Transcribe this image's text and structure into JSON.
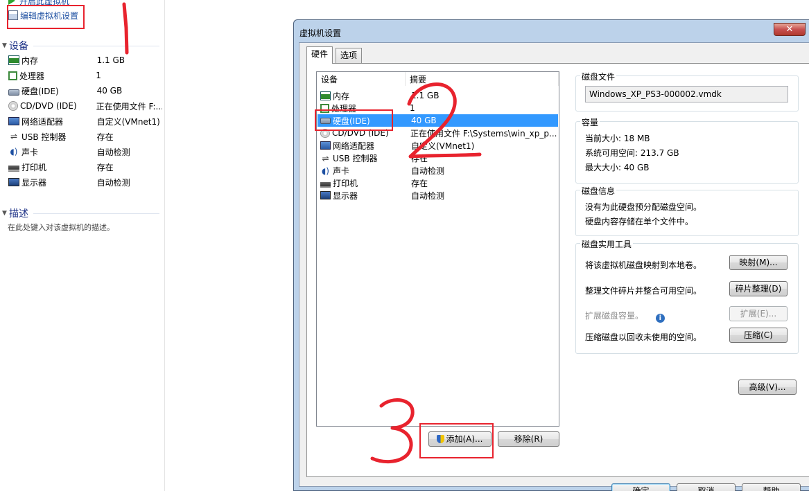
{
  "left_panel": {
    "power_on_label": "开启此虚拟机",
    "edit_settings_label": "编辑虚拟机设置",
    "devices_header": "设备",
    "devices": [
      {
        "name": "内存",
        "value": "1.1 GB",
        "icon": "memory-icon"
      },
      {
        "name": "处理器",
        "value": "1",
        "icon": "cpu-icon"
      },
      {
        "name": "硬盘(IDE)",
        "value": "40 GB",
        "icon": "hard-disk-icon"
      },
      {
        "name": "CD/DVD (IDE)",
        "value": "正在使用文件 F:...",
        "icon": "cd-dvd-icon"
      },
      {
        "name": "网络适配器",
        "value": "自定义(VMnet1)",
        "icon": "network-adapter-icon"
      },
      {
        "name": "USB 控制器",
        "value": "存在",
        "icon": "usb-icon"
      },
      {
        "name": "声卡",
        "value": "自动检测",
        "icon": "sound-card-icon"
      },
      {
        "name": "打印机",
        "value": "存在",
        "icon": "printer-icon"
      },
      {
        "name": "显示器",
        "value": "自动检测",
        "icon": "display-icon"
      }
    ],
    "description_header": "描述",
    "description_placeholder": "在此处键入对该虚拟机的描述。"
  },
  "dialog": {
    "title": "虚拟机设置",
    "close_glyph": "✕",
    "tabs": [
      {
        "label": "硬件"
      },
      {
        "label": "选项"
      }
    ],
    "device_list": {
      "col_device": "设备",
      "col_summary": "摘要",
      "rows": [
        {
          "name": "内存",
          "value": "1.1 GB"
        },
        {
          "name": "处理器",
          "value": "1"
        },
        {
          "name": "硬盘(IDE)",
          "value": "40 GB"
        },
        {
          "name": "CD/DVD (IDE)",
          "value": "正在使用文件 F:\\Systems\\win_xp_p..."
        },
        {
          "name": "网络适配器",
          "value": "自定义(VMnet1)"
        },
        {
          "name": "USB 控制器",
          "value": "存在"
        },
        {
          "name": "声卡",
          "value": "自动检测"
        },
        {
          "name": "打印机",
          "value": "存在"
        },
        {
          "name": "显示器",
          "value": "自动检测"
        }
      ],
      "selected_index": 2
    },
    "add_button": "添加(A)...",
    "remove_button": "移除(R)",
    "disk_file": {
      "title": "磁盘文件",
      "value": "Windows_XP_PS3-000002.vmdk"
    },
    "capacity": {
      "title": "容量",
      "current_size": "当前大小: 18 MB",
      "system_free": "系统可用空间: 213.7 GB",
      "max_size": "最大大小: 40 GB"
    },
    "disk_info": {
      "title": "磁盘信息",
      "line1": "没有为此硬盘预分配磁盘空间。",
      "line2": "硬盘内容存储在单个文件中。"
    },
    "disk_utilities": {
      "title": "磁盘实用工具",
      "map_text": "将该虚拟机磁盘映射到本地卷。",
      "map_button": "映射(M)...",
      "defrag_text": "整理文件碎片并整合可用空间。",
      "defrag_button": "碎片整理(D)",
      "expand_text": "扩展磁盘容量。",
      "expand_button": "扩展(E)...",
      "compact_text": "压缩磁盘以回收未使用的空间。",
      "compact_button": "压缩(C)"
    },
    "advanced_button": "高级(V)...",
    "ok_button": "确定",
    "cancel_button": "取消",
    "help_button": "帮助"
  },
  "colors": {
    "annotation_red": "#e8232e",
    "selection_blue": "#3399ff",
    "link_blue": "#1e50a2"
  }
}
